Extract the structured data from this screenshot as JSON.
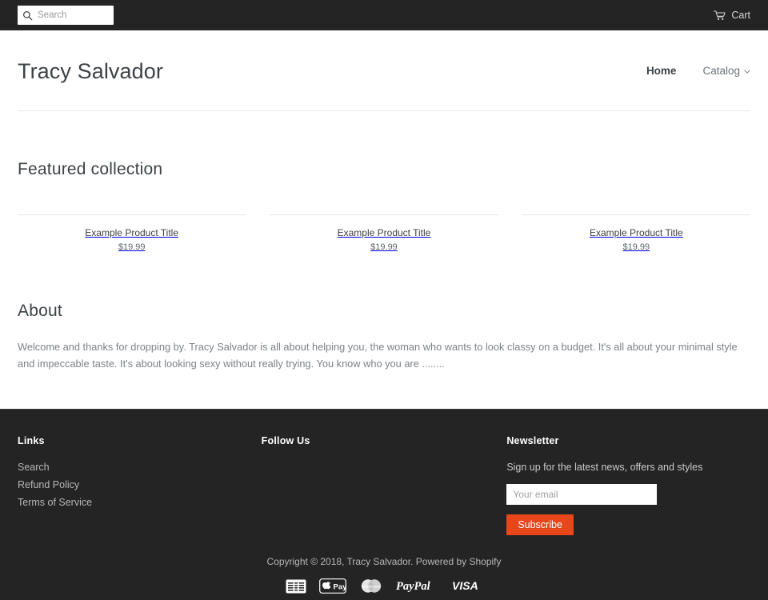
{
  "topbar": {
    "search": {
      "placeholder": "Search",
      "value": "",
      "icon": "search-icon"
    },
    "cart": {
      "label": "Cart",
      "icon": "cart-icon"
    }
  },
  "header": {
    "site_title": "Tracy Salvador",
    "nav": [
      {
        "label": "Home",
        "active": true
      },
      {
        "label": "Catalog",
        "active": false,
        "icon": "chevron-down-icon"
      }
    ]
  },
  "main": {
    "featured": {
      "heading": "Featured collection",
      "products": [
        {
          "title": "Example Product Title",
          "price": "$19.99"
        },
        {
          "title": "Example Product Title",
          "price": "$19.99"
        },
        {
          "title": "Example Product Title",
          "price": "$19.99"
        }
      ]
    },
    "about": {
      "heading": "About",
      "body": "Welcome and thanks for dropping by. Tracy Salvador is all about helping you, the woman who wants to look classy on a budget. It's all about your minimal style and impeccable taste. It's about looking sexy without really trying. You know who you are ........"
    }
  },
  "footer": {
    "links": {
      "heading": "Links",
      "items": [
        {
          "label": "Search"
        },
        {
          "label": "Refund Policy"
        },
        {
          "label": "Terms of Service"
        }
      ]
    },
    "follow": {
      "heading": "Follow Us"
    },
    "newsletter": {
      "heading": "Newsletter",
      "description": "Sign up for the latest news, offers and styles",
      "email_placeholder": "Your email",
      "email_value": "",
      "subscribe_label": "Subscribe"
    },
    "copyright": "Copyright © 2018, Tracy Salvador. Powered by Shopify",
    "payment_icons": [
      {
        "name": "american-express-icon",
        "label": "American Express"
      },
      {
        "name": "apple-pay-icon",
        "label": "Apple Pay"
      },
      {
        "name": "mastercard-icon",
        "label": "Mastercard"
      },
      {
        "name": "paypal-icon",
        "label": "PayPal"
      },
      {
        "name": "visa-icon",
        "label": "VISA"
      }
    ]
  },
  "colors": {
    "dark": "#242424",
    "accent": "#e8461b",
    "text": "#3d4246",
    "muted": "#7d8287"
  }
}
